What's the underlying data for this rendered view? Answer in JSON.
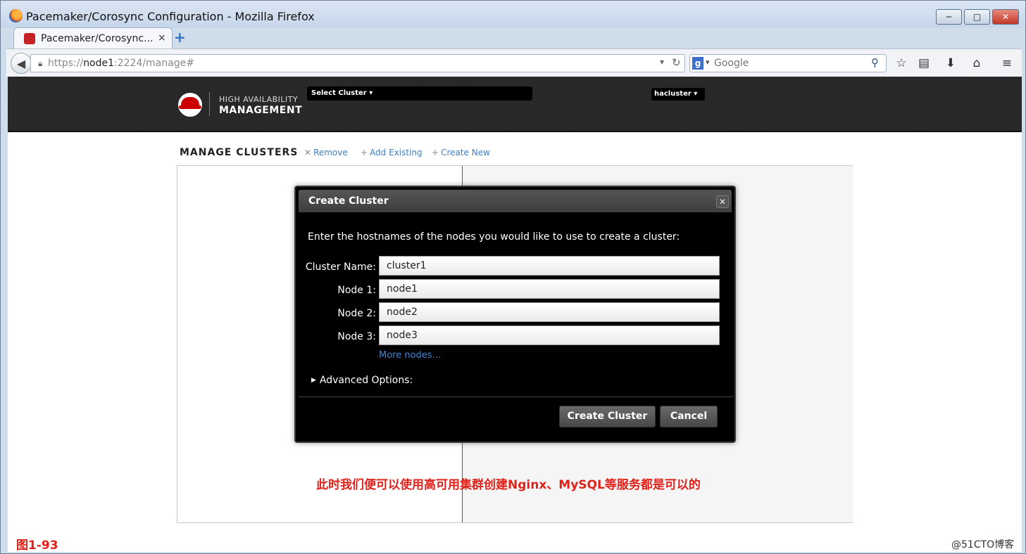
{
  "window": {
    "title": "Pacemaker/Corosync Configuration - Mozilla Firefox",
    "controls": {
      "minimize": "─",
      "maximize": "□",
      "close": "✕"
    }
  },
  "tabs": [
    {
      "label": "Pacemaker/Corosync...",
      "close": "×"
    }
  ],
  "newtab_symbol": "+",
  "nav": {
    "url_prefix": "https://",
    "url_host": "node1",
    "url_rest": ":2224/manage#",
    "search_placeholder": "Google",
    "search_engine": "g"
  },
  "header": {
    "logo_line1": "HIGH AVAILABILITY",
    "logo_line2": "MANAGEMENT",
    "select_cluster": "Select Cluster ▾",
    "user": "hacluster ▾"
  },
  "manage": {
    "title": "MANAGE CLUSTERS",
    "actions": [
      {
        "symbol": "✕",
        "label": "Remove"
      },
      {
        "symbol": "+",
        "label": "Add Existing"
      },
      {
        "symbol": "+",
        "label": "Create New"
      }
    ]
  },
  "modal": {
    "title": "Create Cluster",
    "close": "✕",
    "description": "Enter the hostnames of the nodes you would like to use to create a cluster:",
    "fields": [
      {
        "label": "Cluster Name:",
        "value": "cluster1"
      },
      {
        "label": "Node 1:",
        "value": "node1"
      },
      {
        "label": "Node 2:",
        "value": "node2"
      },
      {
        "label": "Node 3:",
        "value": "node3"
      }
    ],
    "more_nodes": "More nodes...",
    "advanced": "Advanced Options:",
    "create_button": "Create Cluster",
    "cancel_button": "Cancel"
  },
  "annotation": "此时我们便可以使用高可用集群创建Nginx、MySQL等服务都是可以的",
  "figure_label": "图1-93",
  "watermark": "@51CTO博客",
  "colors": {
    "annotation": "#e0221b",
    "link": "#3f7ec1",
    "header_bg": "#2b2b2b",
    "modal_bg": "#000000"
  }
}
